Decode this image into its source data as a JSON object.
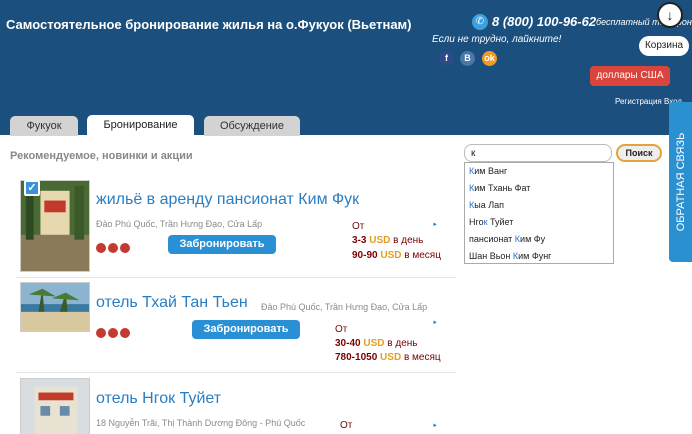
{
  "header": {
    "title": "Самостоятельное бронирование жилья на о.Фукуок (Вьетнам)",
    "phone": "8 (800) 100-96-62",
    "phone_note": "бесплатный телефон",
    "like_text": "Если не трудно, лайкните!",
    "social": [
      "f",
      "B",
      "ok"
    ],
    "cart_label": "Корзина",
    "currency_label": "доллары США",
    "login_label": "Регистрация   Вход"
  },
  "tabs": [
    {
      "label": "Фукуок",
      "active": false
    },
    {
      "label": "Бронирование",
      "active": true
    },
    {
      "label": "Обсуждение",
      "active": false
    }
  ],
  "section_title": "Рекомендуемое, новинки и акции",
  "search": {
    "value": "к",
    "button_label": "Поиск",
    "suggestions": [
      {
        "pre": "",
        "hl": "К",
        "post": "им Ванг"
      },
      {
        "pre": "",
        "hl": "К",
        "post": "им Тхань Фат"
      },
      {
        "pre": "",
        "hl": "К",
        "post": "ыа Лап"
      },
      {
        "pre": "Нго",
        "hl": "к",
        "post": " Туйет"
      },
      {
        "pre": "пансионат ",
        "hl": "К",
        "post": "им Фу"
      },
      {
        "pre": "Шан Вьон ",
        "hl": "К",
        "post": "им Фунг"
      }
    ]
  },
  "feedback_label": "ОБРАТНАЯ СВЯЗЬ",
  "listings": [
    {
      "name": "жильё в аренду пансионат Ким Фук",
      "address": "Đảo Phú Quốc, Trần Hưng Đạo, Cửa Lấp",
      "book_label": "Забронировать",
      "from_label": "От",
      "day_range": "3-3",
      "month_range": "90-90",
      "currency": "USD",
      "per_day": "в день",
      "per_month": "в месяц"
    },
    {
      "name": "отель Тхай Тан Тьен",
      "address": "Đảo Phú Quốc, Trần Hưng Đạo, Cửa Lấp",
      "book_label": "Забронировать",
      "from_label": "От",
      "day_range": "30-40",
      "month_range": "780-1050",
      "currency": "USD",
      "per_day": "в день",
      "per_month": "в месяц"
    },
    {
      "name": "отель Нгок Туйет",
      "address": "18 Nguyễn Trãi, Thị Thành Dương Đông - Phú Quốc",
      "from_label": "От"
    }
  ],
  "colors": {
    "header_bg": "#1b4f7e",
    "link_blue": "#2a7ec2",
    "button_blue": "#2a90d6",
    "price_red": "#7a0000",
    "currency_gold": "#e3a020",
    "currency_button_red": "#d9453c"
  }
}
